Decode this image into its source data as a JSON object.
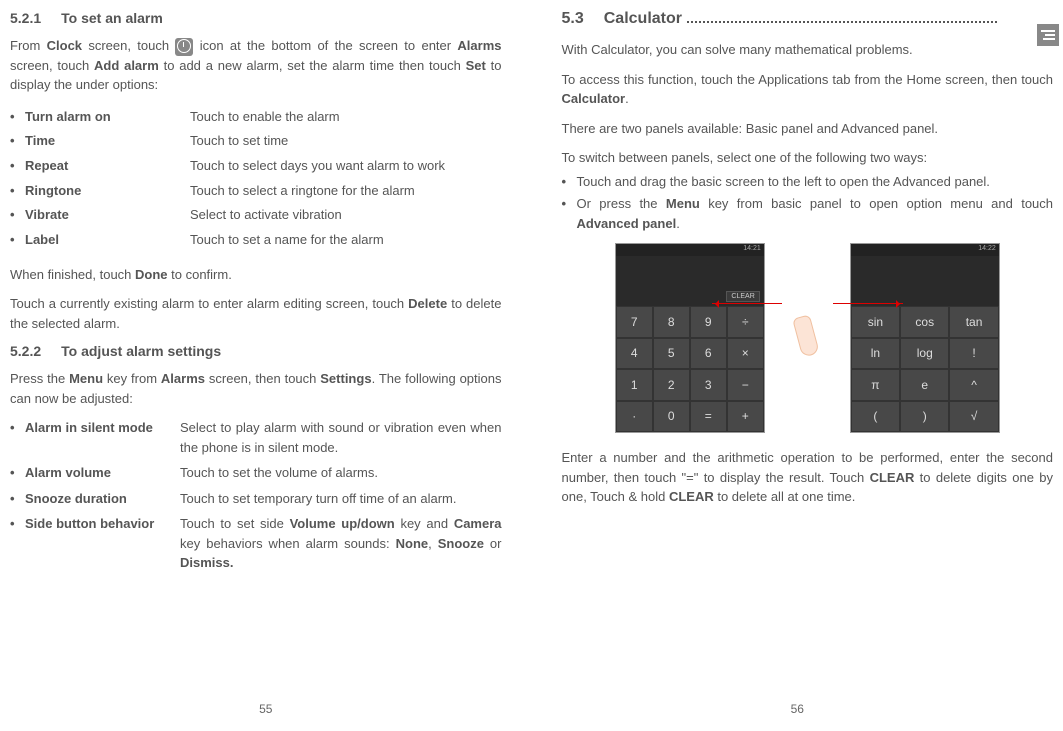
{
  "left": {
    "sec1": {
      "num": "5.2.1",
      "title": "To set an alarm"
    },
    "intro": {
      "p1a": "From ",
      "p1b": "Clock",
      "p1c": " screen, touch ",
      "p1d": " icon at the bottom of the screen to enter ",
      "p1e": "Alarms",
      "p1f": " screen, touch ",
      "p1g": "Add alarm",
      "p1h": " to add a new alarm, set the alarm time then touch ",
      "p1i": "Set",
      "p1j": " to display the under options:"
    },
    "options": [
      {
        "label": "Turn alarm on",
        "desc": "Touch to enable the alarm"
      },
      {
        "label": "Time",
        "desc": "Touch to set time"
      },
      {
        "label": "Repeat",
        "desc": "Touch to select days you want alarm to work"
      },
      {
        "label": "Ringtone",
        "desc": "Touch to select a ringtone for the alarm"
      },
      {
        "label": "Vibrate",
        "desc": "Select to activate vibration"
      },
      {
        "label": "Label",
        "desc": "Touch to set a name for the alarm"
      }
    ],
    "done": {
      "a": "When finished, touch ",
      "b": "Done",
      "c": " to confirm."
    },
    "delete": {
      "a": "Touch a currently existing alarm to enter alarm editing screen, touch ",
      "b": "Delete",
      "c": " to delete the selected alarm."
    },
    "sec2": {
      "num": "5.2.2",
      "title": "To adjust alarm settings"
    },
    "settingsIntro": {
      "a": "Press the ",
      "b": "Menu",
      "c": " key from ",
      "d": "Alarms",
      "e": " screen, then touch ",
      "f": "Settings",
      "g": ". The following options can now be adjusted:"
    },
    "settings": [
      {
        "label": "Alarm in silent mode",
        "desc": "Select to play alarm with sound or vibration even when the phone is in silent mode."
      },
      {
        "label": "Alarm volume",
        "desc": "Touch to set the volume of alarms."
      },
      {
        "label": "Snooze duration",
        "desc": "Touch to set temporary turn off time of an alarm."
      },
      {
        "label": "Side button behavior",
        "desc_a": "Touch to set side ",
        "desc_b": "Volume up/down",
        "desc_c": " key and ",
        "desc_d": "Camera",
        "desc_e": " key behaviors when alarm sounds: ",
        "desc_f": "None",
        "desc_g": ", ",
        "desc_h": "Snooze",
        "desc_i": " or ",
        "desc_j": "Dismiss."
      }
    ],
    "pageNum": "55"
  },
  "right": {
    "sec": {
      "num": "5.3",
      "title": "Calculator"
    },
    "p1": "With Calculator, you can solve many mathematical problems.",
    "p2": {
      "a": "To access this function, touch the Applications tab from the Home screen, then touch ",
      "b": "Calculator",
      "c": "."
    },
    "p3": "There are two panels available: Basic panel and Advanced panel.",
    "p4": "To switch between panels, select one of the following two ways:",
    "bullets": {
      "b1": "Touch and drag the basic screen to the left to open the Advanced panel.",
      "b2a": "Or press the ",
      "b2b": "Menu",
      "b2c": " key from basic panel to open option menu and touch ",
      "b2d": "Advanced panel",
      "b2e": "."
    },
    "calcBasic": {
      "time": "14:21",
      "clear": "CLEAR",
      "keys": [
        "7",
        "8",
        "9",
        "÷",
        "4",
        "5",
        "6",
        "×",
        "1",
        "2",
        "3",
        "−",
        "·",
        "0",
        "=",
        "+"
      ]
    },
    "calcAdv": {
      "time": "14:22",
      "keys": [
        "sin",
        "cos",
        "tan",
        "ln",
        "log",
        "!",
        "π",
        "e",
        "^",
        "(",
        ")",
        "√"
      ]
    },
    "p5": {
      "a": "Enter a number and the arithmetic operation to be performed, enter the second number, then touch \"=\" to display the result. Touch ",
      "b": "CLEAR",
      "c": " to delete digits one by one, Touch & hold ",
      "d": "CLEAR",
      "e": " to delete all at one time."
    },
    "pageNum": "56"
  }
}
